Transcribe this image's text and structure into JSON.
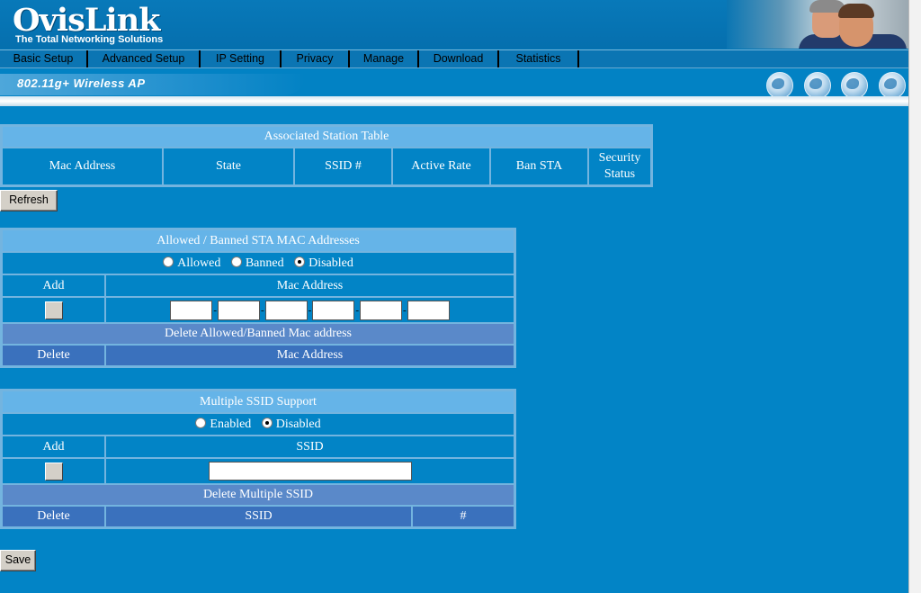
{
  "brand": {
    "name": "OvisLink",
    "tagline": "The Total Networking Solutions"
  },
  "nav": [
    "Basic Setup",
    "Advanced Setup",
    "IP Setting",
    "Privacy",
    "Manage",
    "Download",
    "Statistics"
  ],
  "subtitle": "802.11g+ Wireless AP",
  "station_table": {
    "title": "Associated Station Table",
    "columns": [
      "Mac Address",
      "State",
      "SSID #",
      "Active Rate",
      "Ban STA",
      "Security Status"
    ]
  },
  "refresh_label": "Refresh",
  "mac_filter": {
    "title": "Allowed / Banned STA MAC Addresses",
    "options": [
      "Allowed",
      "Banned",
      "Disabled"
    ],
    "selected": "Disabled",
    "add_label": "Add",
    "mac_label": "Mac Address",
    "delete_title": "Delete Allowed/Banned Mac address",
    "delete_label": "Delete",
    "delete_mac_label": "Mac Address"
  },
  "multi_ssid": {
    "title": "Multiple SSID Support",
    "options": [
      "Enabled",
      "Disabled"
    ],
    "selected": "Disabled",
    "add_label": "Add",
    "ssid_label": "SSID",
    "delete_title": "Delete Multiple SSID",
    "delete_label": "Delete",
    "delete_ssid_label": "SSID",
    "hash_label": "#"
  },
  "save_label": "Save"
}
